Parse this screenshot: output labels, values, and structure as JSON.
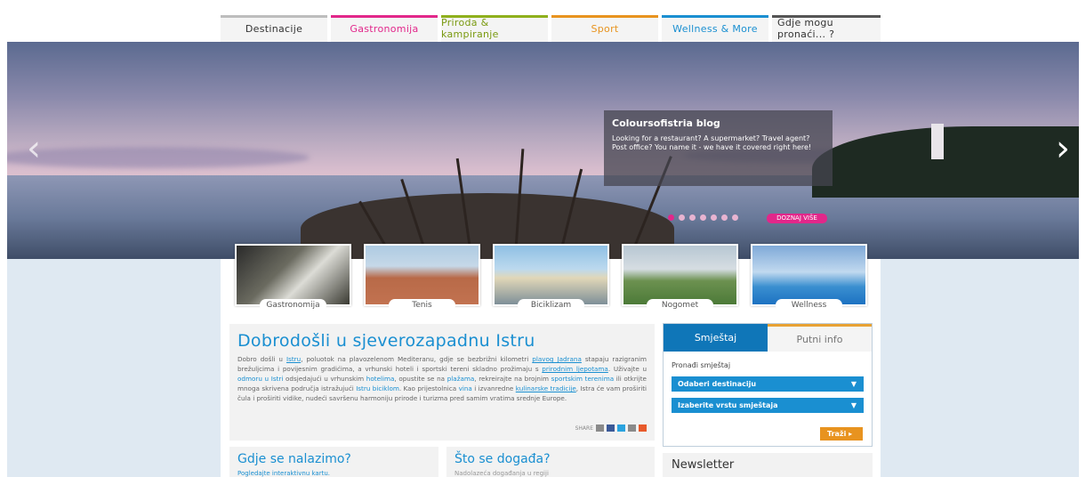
{
  "nav": {
    "tabs": [
      {
        "label": "Destinacije",
        "color": "#bdbdbd",
        "text_color": "#333333"
      },
      {
        "label": "Gastronomija",
        "color": "#e2278a",
        "text_color": "#e2278a"
      },
      {
        "label": "Priroda & kampiranje",
        "color": "#8fb01c",
        "text_color": "#7a9a10"
      },
      {
        "label": "Sport",
        "color": "#e8931f",
        "text_color": "#e8931f"
      },
      {
        "label": "Wellness & More",
        "color": "#1a8fd1",
        "text_color": "#1a8fd1"
      },
      {
        "label": "Gdje mogu pronaći... ?",
        "color": "#555555",
        "text_color": "#333333"
      }
    ]
  },
  "hero": {
    "blog_title": "Coloursofistria blog",
    "blog_text": "Looking for a restaurant? A supermarket? Travel agent? Post office? You name it - we have it covered right here!",
    "more_button": "DOZNAJ VIŠE",
    "slide_count": 7,
    "active_slide": 1,
    "prev_arrow": "‹",
    "next_arrow": "›"
  },
  "categories": [
    "Gastronomija",
    "Tenis",
    "Biciklizam",
    "Nogomet",
    "Wellness"
  ],
  "welcome": {
    "title": "Dobrodošli u sjeverozapadnu Istru",
    "p1": "Dobro došli u ",
    "link_istru": "Istru",
    "p2": ", poluotok na plavozelenom Mediteranu, gdje se bezbrižni kilometri ",
    "link_plavog": "plavog Jadrana",
    "p3": " stapaju razigranim brežuljcima i povijesnim gradićima, a vrhunski hoteli i sportski tereni skladno prožimaju s ",
    "link_prirodnim": "prirodnim ljepotama",
    "p4": ". Uživajte u ",
    "link_odmoru": "odmoru u Istri",
    "p5": " odsjedajući u vrhunskim ",
    "link_hotelima": "hotelima",
    "p6": ", opustite se na ",
    "link_plazama": "plažama",
    "p7": ", rekreirajte na brojnim ",
    "link_tereni": "sportskim terenima",
    "p8": " ili otkrijte mnoga skrivena područja istražujući ",
    "link_bicikl": "Istru biciklom",
    "p9": ". Kao prijestolnica ",
    "link_vina": "vina",
    "p10": " i izvanredne ",
    "link_kulinar": "kulinarske tradicije",
    "p11": ", Istra će vam proširiti čula i proširiti vidike, nudeći savršenu harmoniju prirode i turizma pred samim vratima srednje Europe.",
    "share_label": "SHARE"
  },
  "where": {
    "title": "Gdje se nalazimo?",
    "sub": "Pogledajte interaktivnu kartu."
  },
  "events": {
    "title": "Što se događa?",
    "sub": "Nadolazeća događanja u regiji"
  },
  "accommodation": {
    "tab_active": "Smještaj",
    "tab_inactive": "Putni info",
    "label": "Pronađi smještaj",
    "select1": "Odaberi destinaciju",
    "select2": "Izaberite vrstu smještaja",
    "search": "Traži"
  },
  "newsletter": {
    "title": "Newsletter"
  }
}
